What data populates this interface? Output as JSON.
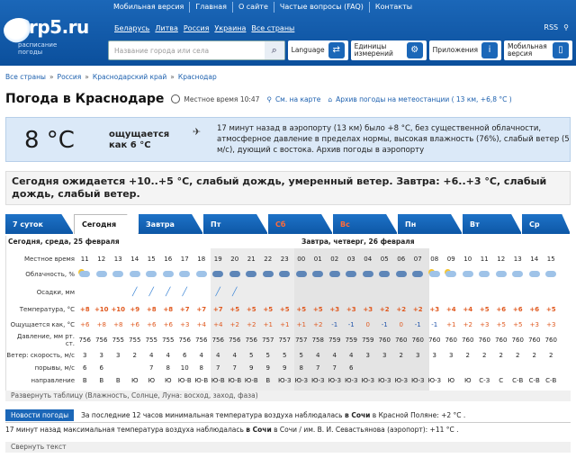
{
  "topnav": [
    "Мобильная версия",
    "Главная",
    "О сайте",
    "Частые вопросы (FAQ)",
    "Контакты"
  ],
  "logo": {
    "name": "rp5.ru",
    "sub": "расписание погоды"
  },
  "countries": [
    "Беларусь",
    "Литва",
    "Россия",
    "Украина",
    "Все страны"
  ],
  "rss": "RSS",
  "search": {
    "placeholder": "Название города или села"
  },
  "tools": {
    "language": "Language",
    "units": "Единицы измерений",
    "apps": "Приложения",
    "mobile": "Мобильная версия"
  },
  "breadcrumb": [
    "Все страны",
    "Россия",
    "Краснодарский край",
    "Краснодар"
  ],
  "title": "Погода в Краснодаре",
  "local_time": "Местное время 10:47",
  "map_link": "См. на карте",
  "archive_link": "Архив погоды на метеостанции ( 13 км, +6,8 °C )",
  "current": {
    "temp": "8 °C",
    "feels": "ощущается как 6 °C",
    "desc": "17 минут назад в аэропорту (13 км) было +8 °C, без существенной облачности, атмосферное давление в пределах нормы, высокая влажность (76%), слабый ветер (5 м/с), дующий с востока. Архив погоды в аэропорту"
  },
  "forecast_text": "Сегодня ожидается +10..+5 °C, слабый дождь, умеренный ветер. Завтра: +6..+3 °C, слабый дождь, слабый ветер.",
  "tabs": [
    "7 суток",
    "Сегодня",
    "Завтра",
    "Пт",
    "Сб",
    "Вс",
    "Пн",
    "Вт",
    "Ср"
  ],
  "day1": "Сегодня, среда, 25 февраля",
  "day2": "Завтра, четверг, 26 февраля",
  "labels": {
    "time": "Местное время",
    "cloud": "Облачность, %",
    "precip": "Осадки, мм",
    "temp": "Температура, °C",
    "feels": "Ощущается как, °C",
    "pressure": "Давление, мм рт. ст.",
    "wind": "Ветер: скорость, м/с",
    "gusts": "порывы, м/с",
    "dir": "направление"
  },
  "hours": [
    "11",
    "12",
    "13",
    "14",
    "15",
    "16",
    "17",
    "18",
    "19",
    "20",
    "21",
    "22",
    "23",
    "00",
    "01",
    "02",
    "03",
    "04",
    "05",
    "06",
    "07",
    "08",
    "09",
    "10",
    "11",
    "12",
    "13",
    "14",
    "15"
  ],
  "temps": [
    "+8",
    "+10",
    "+10",
    "+9",
    "+8",
    "+8",
    "+7",
    "+7",
    "+7",
    "+5",
    "+5",
    "+5",
    "+5",
    "+5",
    "+5",
    "+3",
    "+3",
    "+3",
    "+2",
    "+2",
    "+2",
    "+3",
    "+4",
    "+4",
    "+5",
    "+6",
    "+6",
    "+6",
    "+5"
  ],
  "feels": [
    "+6",
    "+8",
    "+8",
    "+6",
    "+6",
    "+6",
    "+3",
    "+4",
    "+4",
    "+2",
    "+2",
    "+1",
    "+1",
    "+1",
    "+2",
    "-1",
    "-1",
    "0",
    "-1",
    "0",
    "-1",
    "-1",
    "+1",
    "+2",
    "+3",
    "+5",
    "+5",
    "+3",
    "+3"
  ],
  "pressure": [
    "756",
    "756",
    "755",
    "755",
    "755",
    "755",
    "756",
    "756",
    "756",
    "756",
    "756",
    "757",
    "757",
    "757",
    "758",
    "759",
    "759",
    "759",
    "760",
    "760",
    "760",
    "760",
    "760",
    "760",
    "760",
    "760",
    "760",
    "760",
    "760"
  ],
  "wind": [
    "3",
    "3",
    "3",
    "2",
    "4",
    "4",
    "6",
    "4",
    "4",
    "4",
    "5",
    "5",
    "5",
    "5",
    "4",
    "4",
    "4",
    "3",
    "3",
    "2",
    "3",
    "3",
    "3",
    "2",
    "2",
    "2",
    "2",
    "2",
    "2"
  ],
  "gusts": [
    "6",
    "6",
    "",
    "",
    "7",
    "8",
    "10",
    "8",
    "7",
    "7",
    "9",
    "9",
    "9",
    "8",
    "7",
    "7",
    "6",
    "",
    "",
    "",
    "",
    "",
    "",
    "",
    "",
    "",
    "",
    "",
    ""
  ],
  "dirs": [
    "В",
    "В",
    "В",
    "Ю",
    "Ю",
    "Ю",
    "Ю-В",
    "Ю-В",
    "Ю-В",
    "Ю-В",
    "Ю-В",
    "В",
    "Ю-З",
    "Ю-З",
    "Ю-З",
    "Ю-З",
    "Ю-З",
    "Ю-З",
    "Ю-З",
    "Ю-З",
    "Ю-З",
    "Ю-З",
    "Ю",
    "Ю",
    "С-З",
    "С",
    "С-В",
    "С-В",
    "С-В"
  ],
  "expand": "Развернуть таблицу (Влажность, Солнце, Луна: восход, заход, фаза)",
  "news_badge": "Новости погоды",
  "news1_a": "За последние 12 часов минимальная температура воздуха наблюдалась",
  "news1_b": "в Сочи",
  "news1_c": "в Красной Поляне: +2 °C .",
  "news2_a": "17 минут назад максимальная температура воздуха наблюдалась",
  "news2_b": "в Сочи",
  "news2_c": "в Сочи / им. В. И. Севастьянова (аэропорт): +11 °C .",
  "collapse": "Свернуть текст"
}
